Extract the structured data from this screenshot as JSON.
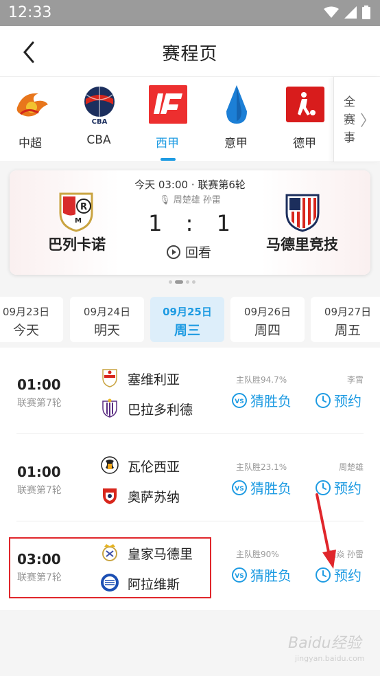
{
  "status_bar": {
    "time": "12:33"
  },
  "header": {
    "title": "赛程页"
  },
  "leagues": [
    {
      "name": "中超",
      "active": false
    },
    {
      "name": "CBA",
      "active": false
    },
    {
      "name": "西甲",
      "active": true
    },
    {
      "name": "意甲",
      "active": false
    },
    {
      "name": "德甲",
      "active": false
    }
  ],
  "all_leagues_label": "全赛事",
  "featured_match": {
    "meta": "今天 03:00 · 联赛第6轮",
    "commentators": "周楚雄 孙雷",
    "home": "巴列卡诺",
    "away": "马德里竞技",
    "home_score": "1",
    "away_score": "1",
    "score_separator": ":",
    "replay_label": "回看"
  },
  "dates": [
    {
      "date": "09月23日",
      "day": "今天",
      "active": false
    },
    {
      "date": "09月24日",
      "day": "明天",
      "active": false
    },
    {
      "date": "09月25日",
      "day": "周三",
      "active": true
    },
    {
      "date": "09月26日",
      "day": "周四",
      "active": false
    },
    {
      "date": "09月27日",
      "day": "周五",
      "active": false
    }
  ],
  "matches": [
    {
      "time": "01:00",
      "round": "联赛第7轮",
      "home": "塞维利亚",
      "away": "巴拉多利德",
      "prediction": "主队胜94.7%",
      "commentator": "李霄",
      "guess_label": "猜胜负",
      "book_label": "预约"
    },
    {
      "time": "01:00",
      "round": "联赛第7轮",
      "home": "瓦伦西亚",
      "away": "奥萨苏纳",
      "prediction": "主队胜23.1%",
      "commentator": "周楚雄",
      "guess_label": "猜胜负",
      "book_label": "预约"
    },
    {
      "time": "03:00",
      "round": "联赛第7轮",
      "home": "皇家马德里",
      "away": "阿拉维斯",
      "prediction": "主队胜90%",
      "commentator": "刘焱 孙雷",
      "guess_label": "猜胜负",
      "book_label": "预约"
    }
  ],
  "watermark": "Baidu经验",
  "watermark_sub": "jingyan.baidu.com",
  "colors": {
    "accent": "#1e9be2",
    "highlight": "#e0262b",
    "status_bar": "#9b9b9b"
  }
}
